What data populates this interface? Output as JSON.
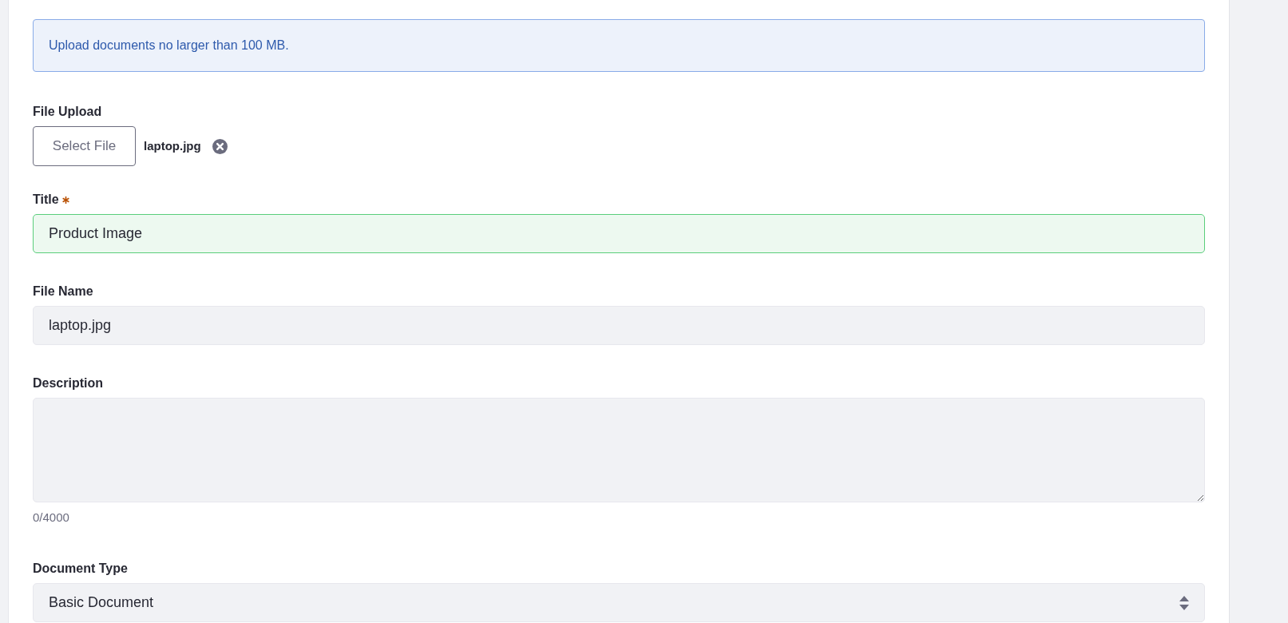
{
  "alert": {
    "text": "Upload documents no larger than 100 MB."
  },
  "fields": [
    {
      "kind": "upload",
      "label": "File Upload",
      "button": "Select File",
      "file_name": "laptop.jpg"
    },
    {
      "kind": "text",
      "label": "Title",
      "required": true,
      "valid": true,
      "value": "Product Image"
    },
    {
      "kind": "text",
      "label": "File Name",
      "required": false,
      "valid": false,
      "value": "laptop.jpg"
    },
    {
      "kind": "textarea",
      "label": "Description",
      "counter": "0/4000"
    },
    {
      "kind": "select",
      "label": "Document Type",
      "value": "Basic Document"
    }
  ]
}
